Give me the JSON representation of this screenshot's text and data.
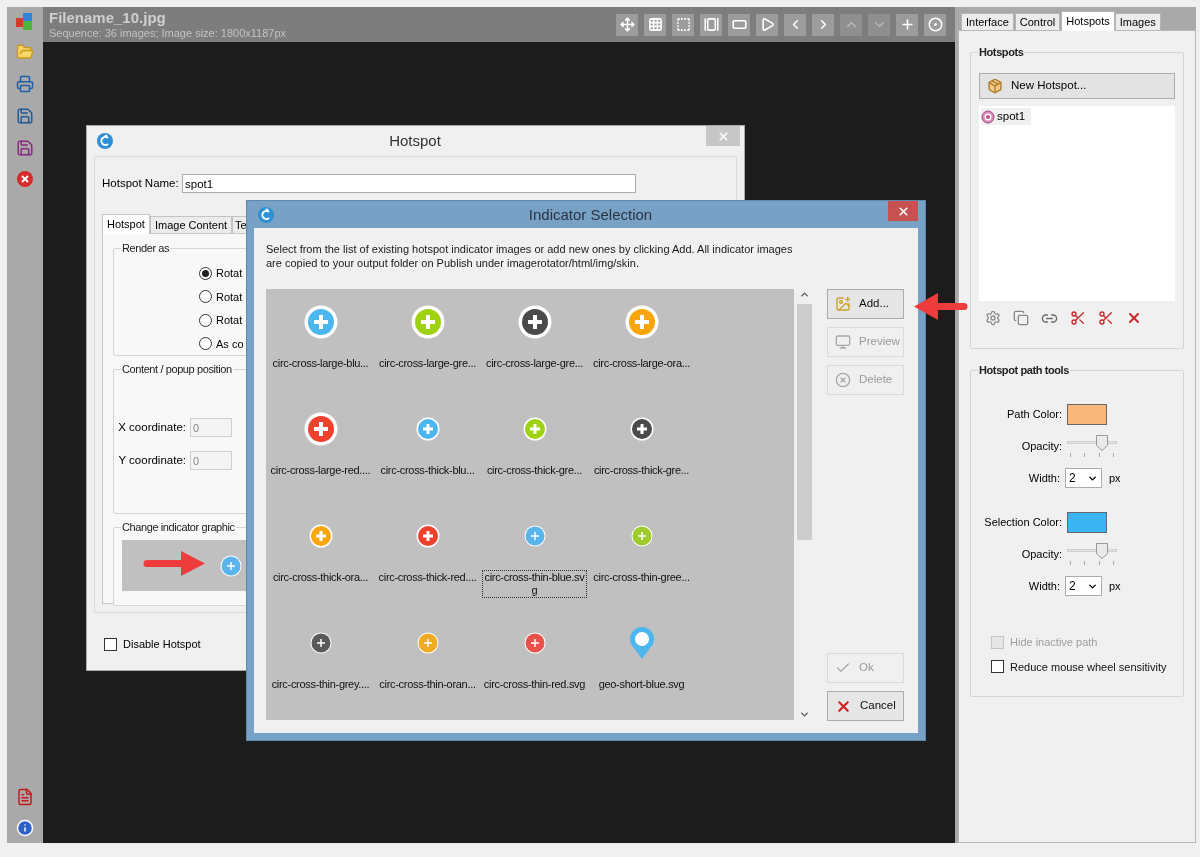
{
  "header": {
    "title": "Filename_10.jpg",
    "subtitle": "Sequence: 36 images; Image size: 1800x1187px"
  },
  "view_toolbar": [
    {
      "disabled": false
    },
    {
      "disabled": false
    },
    {
      "disabled": false
    },
    {
      "disabled": false
    },
    {
      "disabled": false
    },
    {
      "disabled": false
    },
    {
      "disabled": false
    },
    {
      "disabled": false
    },
    {
      "disabled": true
    },
    {
      "disabled": true
    },
    {
      "disabled": false
    },
    {
      "disabled": false
    }
  ],
  "hotspot_dialog": {
    "title": "Hotspot",
    "name_label": "Hotspot Name:",
    "name_value": "spot1",
    "tabs": [
      {
        "label": "Hotspot",
        "selected": true
      },
      {
        "label": "Image Content",
        "selected": false
      },
      {
        "label": "Te",
        "selected": false
      }
    ],
    "render_group": {
      "title": "Render as",
      "options": [
        {
          "label": "Rotat",
          "selected": true
        },
        {
          "label": "Rotat",
          "selected": false
        },
        {
          "label": "Rotat",
          "selected": false
        },
        {
          "label": "As co",
          "selected": false
        }
      ]
    },
    "position_group": {
      "title": "Content / popup position",
      "fields": [
        {
          "label": "X coordinate:",
          "value": "0"
        },
        {
          "label": "Y coordinate:",
          "value": "0"
        }
      ]
    },
    "indicator_group": {
      "title": "Change indicator graphic"
    },
    "disable_checkbox": {
      "label": "Disable Hotspot",
      "checked": false
    }
  },
  "indicator_dialog": {
    "title": "Indicator Selection",
    "description": "Select from the list of existing hotspot indicator images or add new ones by clicking Add. All indicator images are copied to your output folder on Publish under imagerotator/html/img/skin.",
    "items": [
      {
        "label": "circ-cross-large-blu...",
        "kind": "large",
        "color": "#4cb6ee",
        "selected": false
      },
      {
        "label": "circ-cross-large-gre...",
        "kind": "large",
        "color": "#9ed10f",
        "selected": false
      },
      {
        "label": "circ-cross-large-gre...",
        "kind": "large",
        "color": "#4a4a4a",
        "selected": false
      },
      {
        "label": "circ-cross-large-ora...",
        "kind": "large",
        "color": "#f9a60c",
        "selected": false
      },
      {
        "label": "circ-cross-large-red....",
        "kind": "large",
        "color": "#f0412f",
        "selected": false
      },
      {
        "label": "circ-cross-thick-blu...",
        "kind": "thick",
        "color": "#4cb6ee",
        "selected": false
      },
      {
        "label": "circ-cross-thick-gre...",
        "kind": "thick",
        "color": "#9ed10f",
        "selected": false
      },
      {
        "label": "circ-cross-thick-gre...",
        "kind": "thick",
        "color": "#4a4a4a",
        "selected": false
      },
      {
        "label": "circ-cross-thick-ora...",
        "kind": "thick",
        "color": "#f9a60c",
        "selected": false
      },
      {
        "label": "circ-cross-thick-red....",
        "kind": "thick",
        "color": "#f0412f",
        "selected": false
      },
      {
        "label": "circ-cross-thin-blue.svg",
        "kind": "thin",
        "color": "#5cb4ec",
        "selected": true
      },
      {
        "label": "circ-cross-thin-gree...",
        "kind": "thin",
        "color": "#9ecc2d",
        "selected": false
      },
      {
        "label": "circ-cross-thin-grey....",
        "kind": "thin",
        "color": "#5a5a5a",
        "selected": false
      },
      {
        "label": "circ-cross-thin-oran...",
        "kind": "thin",
        "color": "#f0ab25",
        "selected": false
      },
      {
        "label": "circ-cross-thin-red.svg",
        "kind": "thin",
        "color": "#e8524a",
        "selected": false
      },
      {
        "label": "geo-short-blue.svg",
        "kind": "pin",
        "color": "#4cb6ee",
        "selected": false
      }
    ],
    "top_buttons": [
      {
        "label": "Add...",
        "kind": "add",
        "disabled": false
      },
      {
        "label": "Preview",
        "kind": "preview",
        "disabled": true
      },
      {
        "label": "Delete",
        "kind": "delete",
        "disabled": true
      }
    ],
    "bottom_buttons": [
      {
        "label": "Ok",
        "kind": "ok",
        "disabled": true
      },
      {
        "label": "Cancel",
        "kind": "cancel",
        "disabled": false
      }
    ]
  },
  "side_panel": {
    "tabs": [
      {
        "label": "Interface",
        "selected": false
      },
      {
        "label": "Control",
        "selected": false
      },
      {
        "label": "Hotspots",
        "selected": true
      },
      {
        "label": "Images",
        "selected": false
      }
    ],
    "hotspots_group": {
      "title": "Hotspots",
      "new_button": "New Hotspot...",
      "items": [
        {
          "label": "spot1",
          "selected": true
        }
      ]
    },
    "path_tools": {
      "title": "Hotspot path tools",
      "settings": [
        {
          "color_label": "Path Color:",
          "color": "#f9b87a",
          "opacity_label": "Opacity:",
          "level": 0.7,
          "width_label": "Width:",
          "width_value": "2",
          "unit": "px"
        },
        {
          "color_label": "Selection Color:",
          "color": "#3bb4f4",
          "opacity_label": "Opacity:",
          "level": 0.7,
          "width_label": "Width:",
          "width_value": "2",
          "unit": "px"
        }
      ],
      "checkboxes": [
        {
          "label": "Hide inactive path",
          "checked": false,
          "disabled": true
        },
        {
          "label": "Reduce mouse wheel sensitivity",
          "checked": false,
          "disabled": false
        }
      ]
    }
  }
}
